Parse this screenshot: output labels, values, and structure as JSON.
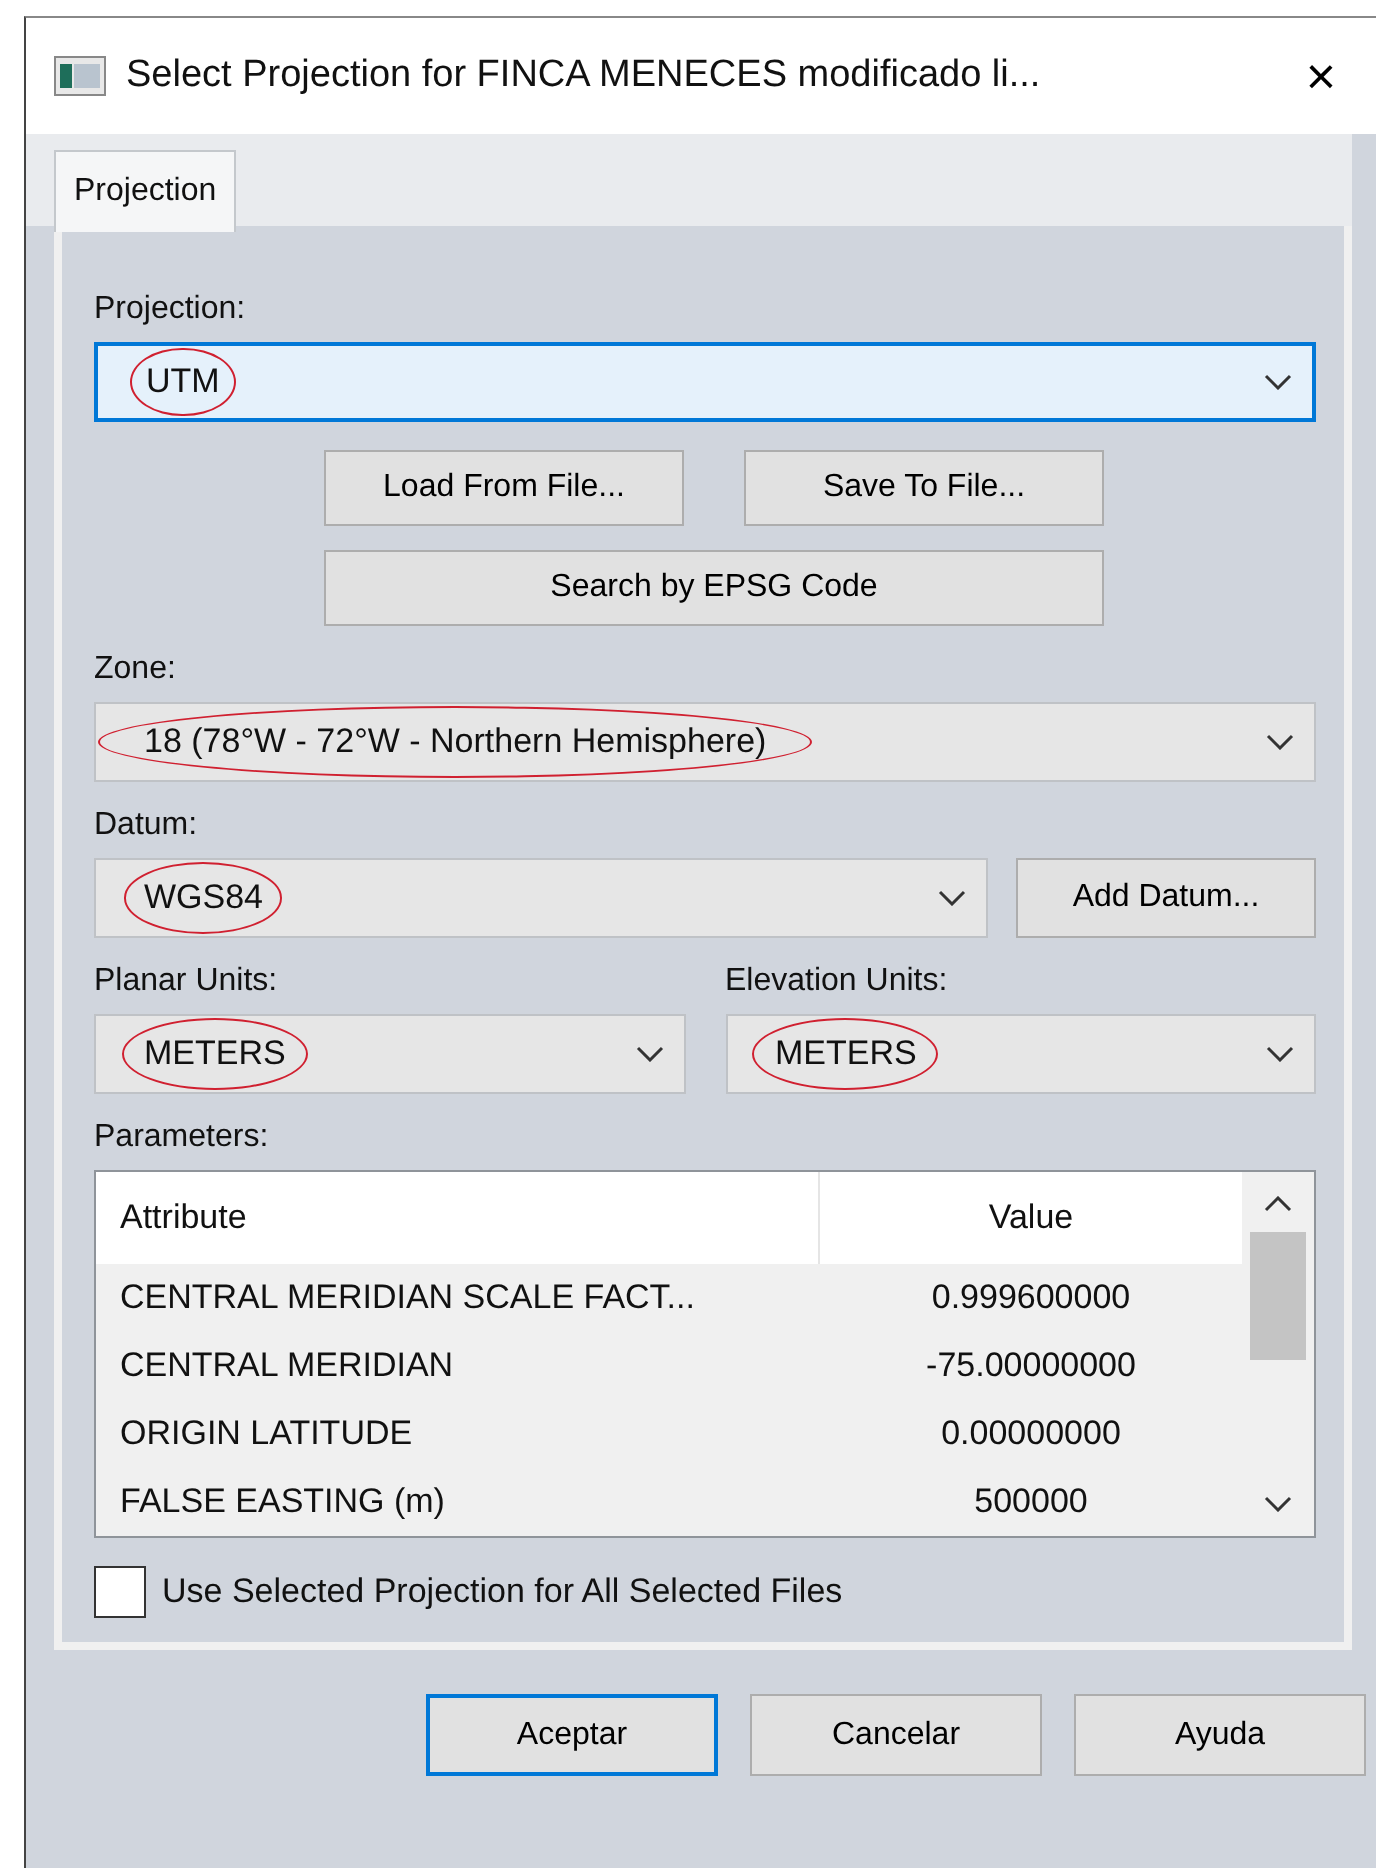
{
  "window": {
    "title": "Select Projection for FINCA MENECES modificado li...",
    "close": "×"
  },
  "tabs": [
    {
      "label": "Projection",
      "selected": true
    }
  ],
  "projection": {
    "label": "Projection:",
    "value": "UTM",
    "focused": true,
    "circled": true
  },
  "file_buttons": [
    "Load From File...",
    "Save To File..."
  ],
  "epsg_button": "Search by EPSG Code",
  "zone": {
    "label": "Zone:",
    "value": "18 (78°W - 72°W - Northern Hemisphere)",
    "circled": true
  },
  "datum": {
    "label": "Datum:",
    "value": "WGS84",
    "circled": true,
    "button": "Add Datum..."
  },
  "planar_units": {
    "label": "Planar Units:",
    "value": "METERS",
    "circled": true
  },
  "elevation_units": {
    "label": "Elevation Units:",
    "value": "METERS",
    "circled": true
  },
  "parameters": {
    "label": "Parameters:",
    "columns": [
      "Attribute",
      "Value"
    ],
    "rows": [
      {
        "attribute": "CENTRAL MERIDIAN SCALE FACT...",
        "value": "0.999600000"
      },
      {
        "attribute": "CENTRAL MERIDIAN",
        "value": "-75.00000000"
      },
      {
        "attribute": "ORIGIN LATITUDE",
        "value": "0.00000000"
      },
      {
        "attribute": "FALSE EASTING (m)",
        "value": "500000"
      }
    ]
  },
  "use_for_all": {
    "label": "Use Selected Projection for All Selected Files",
    "checked": false
  },
  "buttons": [
    {
      "label": "Aceptar",
      "default": true
    },
    {
      "label": "Cancelar",
      "default": false
    },
    {
      "label": "Ayuda",
      "default": false
    }
  ]
}
